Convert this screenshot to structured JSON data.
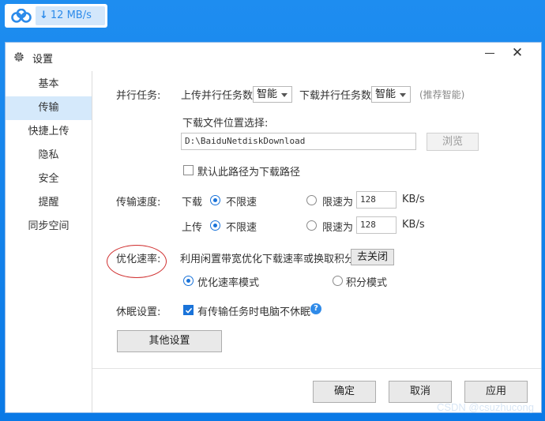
{
  "speed_widget": {
    "app_icon": "baidu-netdisk-cloud-icon",
    "arrow_icon": "download-arrow-icon",
    "speed": "12 MB/s"
  },
  "dialog": {
    "title": "设置",
    "title_icon": "gear-icon"
  },
  "sidebar": {
    "items": [
      {
        "label": "基本",
        "active": false
      },
      {
        "label": "传输",
        "active": true
      },
      {
        "label": "快捷上传",
        "active": false
      },
      {
        "label": "隐私",
        "active": false
      },
      {
        "label": "安全",
        "active": false
      },
      {
        "label": "提醒",
        "active": false
      },
      {
        "label": "同步空间",
        "active": false
      }
    ]
  },
  "parallel": {
    "label": "并行任务:",
    "upload_label": "上传并行任务数",
    "upload_value": "智能",
    "download_label": "下载并行任务数",
    "download_value": "智能",
    "hint": "(推荐智能)"
  },
  "download_location": {
    "label": "下载文件位置选择:",
    "path": "D:\\BaiduNetdiskDownload",
    "browse_label": "浏览",
    "default_checkbox_label": "默认此路径为下载路径",
    "default_checked": false
  },
  "speed": {
    "label": "传输速度:",
    "download": {
      "label": "下载",
      "unlimited_label": "不限速",
      "limit_label": "限速为",
      "limit_value": "128",
      "unit": "KB/s",
      "selected": "unlimited"
    },
    "upload": {
      "label": "上传",
      "unlimited_label": "不限速",
      "limit_label": "限速为",
      "limit_value": "128",
      "unit": "KB/s",
      "selected": "unlimited"
    }
  },
  "optimize": {
    "label": "优化速率:",
    "desc": "利用闲置带宽优化下载速率或换取积分",
    "toggle_label": "去关闭",
    "mode_speed_label": "优化速率模式",
    "mode_points_label": "积分模式",
    "selected": "speed"
  },
  "sleep": {
    "label": "休眠设置:",
    "checkbox_label": "有传输任务时电脑不休眠",
    "checked": true
  },
  "other_settings_label": "其他设置",
  "footer": {
    "ok_label": "确定",
    "cancel_label": "取消",
    "apply_label": "应用"
  },
  "watermark": "CSDN @csuzhucong",
  "colors": {
    "desktop_blue": "#0a79e6",
    "accent": "#1a73d9",
    "nav_active": "#d5e9fb",
    "annotation_red": "#d03030"
  }
}
